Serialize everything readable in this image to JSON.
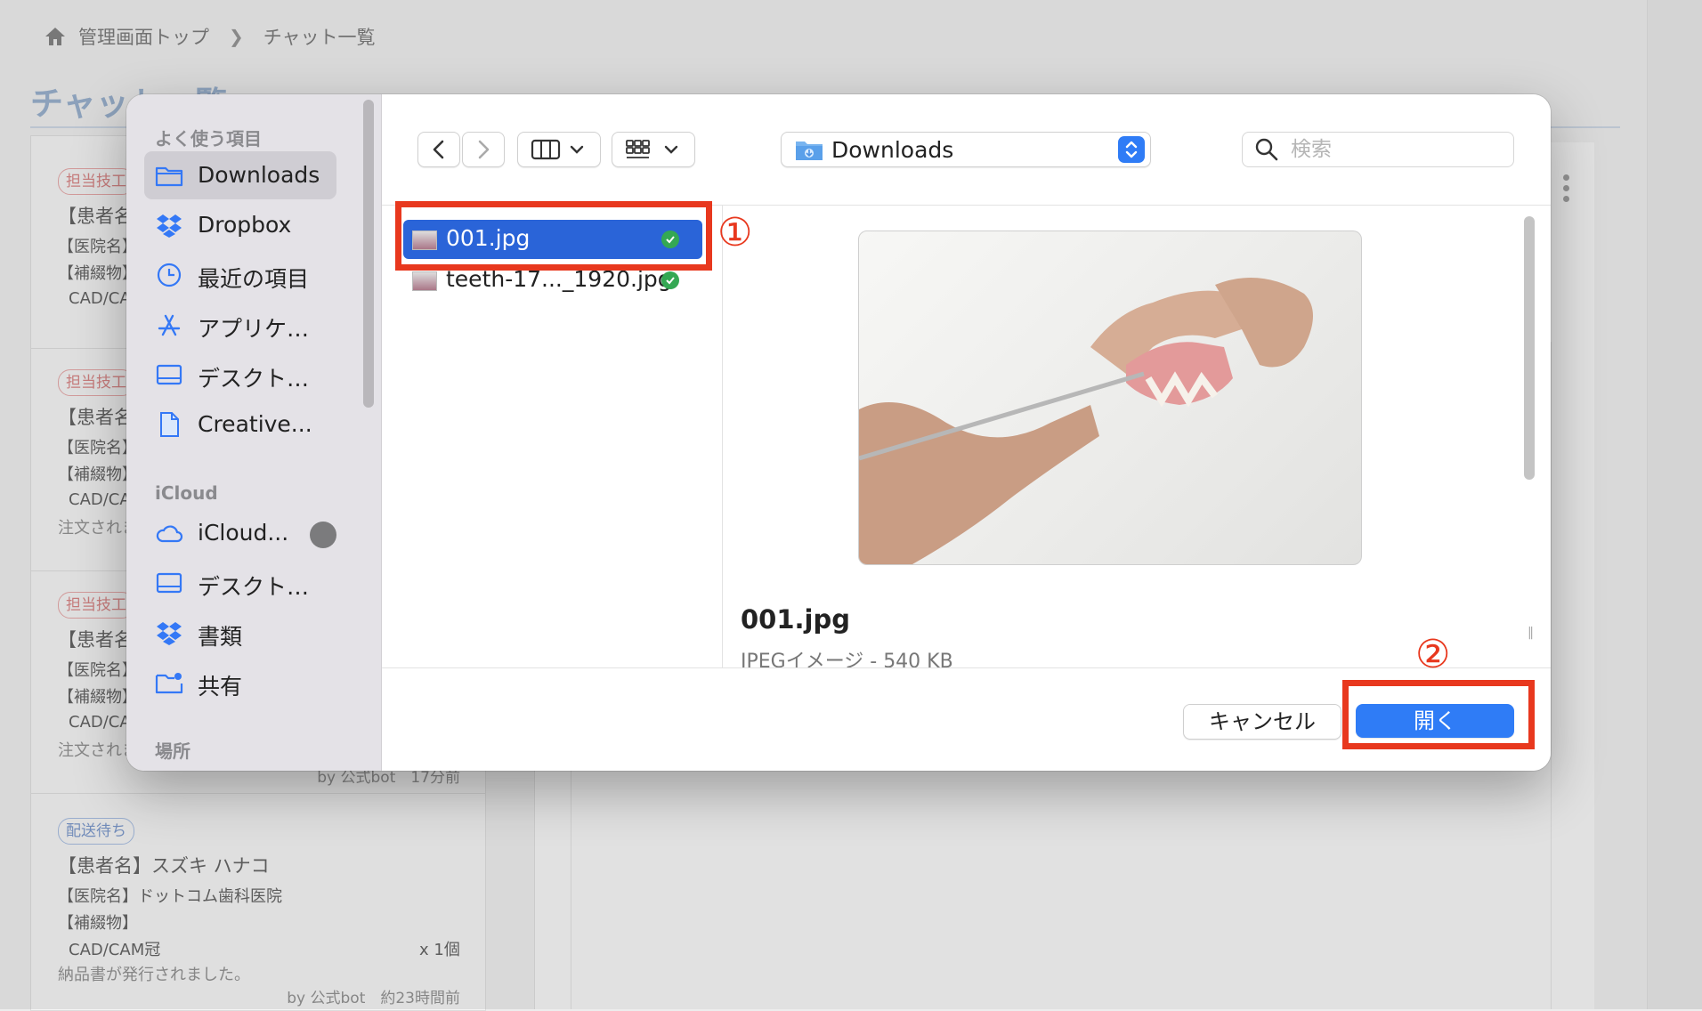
{
  "breadcrumb": {
    "home": "管理画面トップ",
    "current": "チャット一覧"
  },
  "page": {
    "title": "チャット一覧"
  },
  "chat_list": [
    {
      "badge": "担当技工",
      "patient": "【患者名",
      "clinic": "【医院名】",
      "prosthesis": "【補綴物】",
      "item": "CAD/CA"
    },
    {
      "badge": "担当技工",
      "patient": "【患者名",
      "clinic": "【医院名】",
      "prosthesis": "【補綴物】",
      "item": "CAD/CA",
      "message": "注文されま"
    },
    {
      "badge": "担当技工",
      "patient": "【患者名",
      "clinic": "【医院名】",
      "prosthesis": "【補綴物】",
      "item": "CAD/CA",
      "message": "注文されま",
      "meta": "by 公式bot　17分前"
    },
    {
      "badge": "配送待ち",
      "patient": "【患者名】スズキ ハナコ",
      "clinic": "【医院名】ドットコム歯科医院",
      "prosthesis": "【補綴物】",
      "item": "CAD/CAM冠",
      "qty": "x 1個",
      "message": "納品書が発行されました。",
      "meta": "by 公式bot　約23時間前"
    }
  ],
  "dialog": {
    "sidebar": {
      "favorites_header": "よく使う項目",
      "favorites": [
        {
          "label": "Downloads",
          "icon": "folder-icon"
        },
        {
          "label": "Dropbox",
          "icon": "dropbox-icon"
        },
        {
          "label": "最近の項目",
          "icon": "clock-icon"
        },
        {
          "label": "アプリケ…",
          "icon": "app-store-icon"
        },
        {
          "label": "デスクト…",
          "icon": "desktop-icon"
        },
        {
          "label": "Creative...",
          "icon": "document-icon"
        }
      ],
      "icloud_header": "iCloud",
      "icloud": [
        {
          "label": "iCloud...",
          "icon": "cloud-icon"
        },
        {
          "label": "デスクト…",
          "icon": "desktop-icon"
        },
        {
          "label": "書類",
          "icon": "dropbox-icon"
        },
        {
          "label": "共有",
          "icon": "shared-folder-icon"
        }
      ],
      "places_header": "場所"
    },
    "toolbar": {
      "location": "Downloads",
      "search_placeholder": "検索"
    },
    "files": [
      {
        "name": "001.jpg",
        "selected": true
      },
      {
        "name": "teeth-17..._1920.jpg",
        "selected": false
      }
    ],
    "preview": {
      "name": "001.jpg",
      "kind": "JPEGイメージ - 540 KB"
    },
    "buttons": {
      "cancel": "キャンセル",
      "open": "開く"
    }
  },
  "annotations": {
    "step1": "①",
    "step2": "②"
  },
  "colors": {
    "accent": "#2f7cf6",
    "selection": "#2a64d8",
    "annotation": "#e8381e"
  }
}
